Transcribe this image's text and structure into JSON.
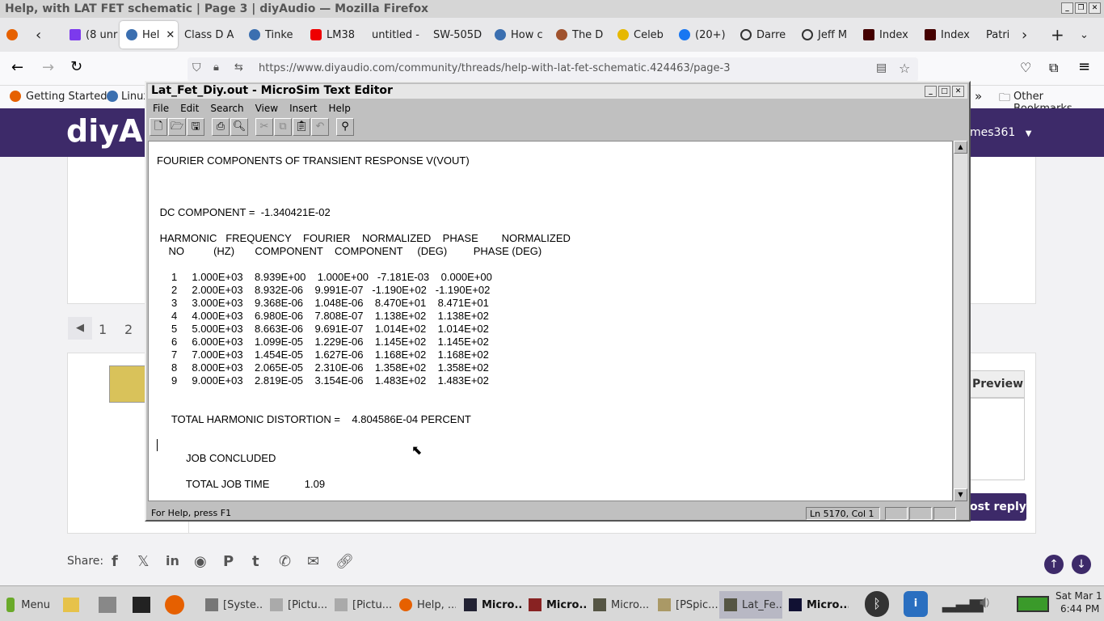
{
  "firefox": {
    "window_title": "Help, with LAT FET schematic | Page 3 | diyAudio — Mozilla Firefox",
    "tabs": [
      "(8 unr",
      "Hel",
      "Class D A",
      "Tinke",
      "LM38",
      "untitled -",
      "SW-505D",
      "How c",
      "The D",
      "Celeb",
      "(20+)",
      "Darre",
      "Jeff M",
      "Index",
      "Index",
      "Patri"
    ],
    "url": "https://www.diyaudio.com/community/threads/help-with-lat-fet-schematic.424463/page-3",
    "bookmarks": [
      "Getting Started",
      "Linux",
      "Other Bookmarks"
    ]
  },
  "site": {
    "logo": "diyAu",
    "username": "mes361",
    "pages": [
      "1",
      "2"
    ],
    "preview_label": "Preview",
    "post_reply_label": "ost reply",
    "share_label": "Share:",
    "share_icons": [
      "facebook-icon",
      "x-icon",
      "linkedin-icon",
      "reddit-icon",
      "pinterest-icon",
      "tumblr-icon",
      "whatsapp-icon",
      "email-icon",
      "link-icon"
    ]
  },
  "editor": {
    "title": "Lat_Fet_Diy.out - MicroSim Text Editor",
    "menu": [
      "File",
      "Edit",
      "Search",
      "View",
      "Insert",
      "Help"
    ],
    "lines": [
      "FOURIER COMPONENTS OF TRANSIENT RESPONSE V(VOUT)",
      " DC COMPONENT =  -1.340421E-02",
      " HARMONIC   FREQUENCY    FOURIER    NORMALIZED    PHASE        NORMALIZED",
      "    NO          (HZ)       COMPONENT    COMPONENT     (DEG)         PHASE (DEG)",
      "     1     1.000E+03    8.939E+00    1.000E+00   -7.181E-03    0.000E+00",
      "     2     2.000E+03    8.932E-06    9.991E-07   -1.190E+02   -1.190E+02",
      "     3     3.000E+03    9.368E-06    1.048E-06    8.470E+01    8.471E+01",
      "     4     4.000E+03    6.980E-06    7.808E-07    1.138E+02    1.138E+02",
      "     5     5.000E+03    8.663E-06    9.691E-07    1.014E+02    1.014E+02",
      "     6     6.000E+03    1.099E-05    1.229E-06    1.145E+02    1.145E+02",
      "     7     7.000E+03    1.454E-05    1.627E-06    1.168E+02    1.168E+02",
      "     8     8.000E+03    2.065E-05    2.310E-06    1.358E+02    1.358E+02",
      "     9     9.000E+03    2.819E-05    3.154E-06    1.483E+02    1.483E+02",
      "     TOTAL HARMONIC DISTORTION =    4.804586E-04 PERCENT",
      "          JOB CONCLUDED",
      "          TOTAL JOB TIME            1.09"
    ],
    "status_help": "For Help, press F1",
    "status_position": "Ln 5170, Col 1"
  },
  "taskbar": {
    "menu_label": "Menu",
    "tasks": [
      "[Syste...",
      "[Pictu...",
      "[Pictu...",
      "Help, ...",
      "Micro...",
      "Micro...",
      "Micro...",
      "[PSpic...",
      "Lat_Fe...",
      "Micro..."
    ],
    "clock_day": "Sat Mar 1",
    "clock_time": "6:44 PM"
  }
}
